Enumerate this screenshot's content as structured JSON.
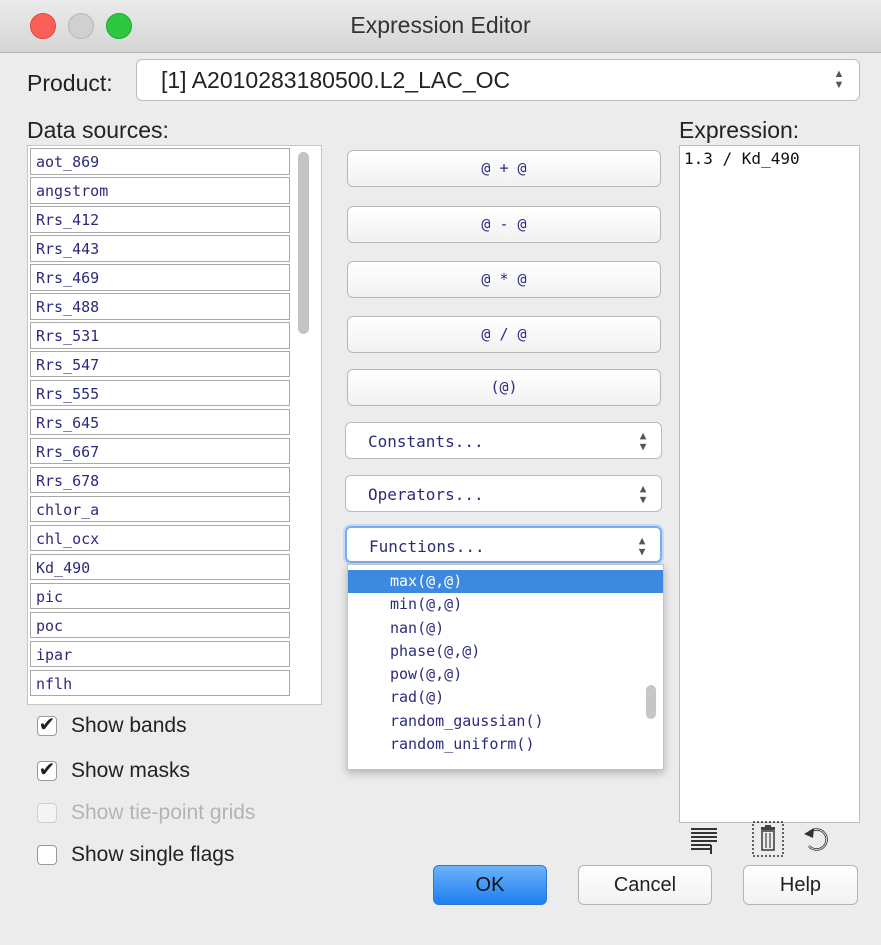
{
  "window": {
    "title": "Expression Editor"
  },
  "product": {
    "label": "Product:",
    "value": "[1] A2010283180500.L2_LAC_OC"
  },
  "data_sources": {
    "label": "Data sources:",
    "items": [
      "aot_869",
      "angstrom",
      "Rrs_412",
      "Rrs_443",
      "Rrs_469",
      "Rrs_488",
      "Rrs_531",
      "Rrs_547",
      "Rrs_555",
      "Rrs_645",
      "Rrs_667",
      "Rrs_678",
      "chlor_a",
      "chl_ocx",
      "Kd_490",
      "pic",
      "poc",
      "ipar",
      "nflh"
    ]
  },
  "checkboxes": [
    {
      "label": "Show bands",
      "checked": true,
      "enabled": true
    },
    {
      "label": "Show masks",
      "checked": true,
      "enabled": true
    },
    {
      "label": "Show tie-point grids",
      "checked": false,
      "enabled": false
    },
    {
      "label": "Show single flags",
      "checked": false,
      "enabled": true
    }
  ],
  "operator_buttons": [
    "@ + @",
    "@ - @",
    "@ * @",
    "@ / @",
    "(@)"
  ],
  "dropdowns": {
    "constants": "Constants...",
    "operators": "Operators...",
    "functions": "Functions..."
  },
  "functions_popup": {
    "items": [
      "max(@,@)",
      "min(@,@)",
      "nan(@)",
      "phase(@,@)",
      "pow(@,@)",
      "rad(@)",
      "random_gaussian()",
      "random_uniform()"
    ],
    "selected_index": 0
  },
  "expression": {
    "label": "Expression:",
    "value": "1.3 / Kd_490"
  },
  "tools": {
    "icons": [
      "history-icon",
      "trash-icon",
      "undo-icon"
    ]
  },
  "buttons": {
    "ok": "OK",
    "cancel": "Cancel",
    "help": "Help"
  },
  "colors": {
    "accent": "#3d89df",
    "mono_text": "#2b2b7b"
  }
}
